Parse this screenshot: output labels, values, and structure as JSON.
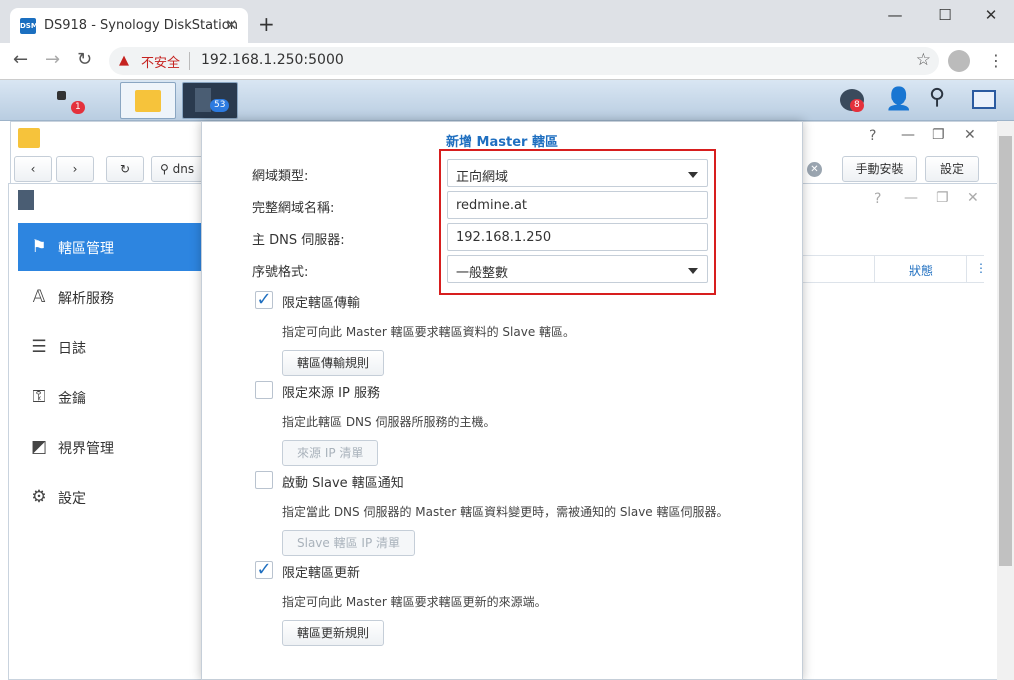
{
  "browser": {
    "tab_title": "DS918 - Synology DiskStation",
    "favicon_text": "DSM",
    "insecure_label": "不安全",
    "url": "192.168.1.250:5000",
    "icons": [
      "back-icon",
      "forward-icon",
      "reload-icon",
      "star-icon",
      "account-icon",
      "menu-icon"
    ]
  },
  "taskbar": {
    "main_menu_badge": "1",
    "dns_badge": "53",
    "notifications_badge": "8"
  },
  "package_center": {
    "search_value": "dns",
    "manual_install_label": "手動安裝",
    "settings_label": "設定"
  },
  "dns_server": {
    "icon_label": "53",
    "sidebar": [
      {
        "label": "轄區管理",
        "icon": "flag-icon",
        "active": true
      },
      {
        "label": "解析服務",
        "icon": "resolve-icon",
        "active": false
      },
      {
        "label": "日誌",
        "icon": "log-icon",
        "active": false
      },
      {
        "label": "金鑰",
        "icon": "key-icon",
        "active": false
      },
      {
        "label": "視界管理",
        "icon": "view-icon",
        "active": false
      },
      {
        "label": "設定",
        "icon": "gear-icon",
        "active": false
      }
    ],
    "table_status_header": "狀態"
  },
  "modal": {
    "title": "新增 Master 轄區",
    "fields": {
      "domain_type_label": "網域類型:",
      "domain_type_value": "正向網域",
      "domain_name_label": "完整網域名稱:",
      "domain_name_value": "redmine.at",
      "dns_server_label": "主 DNS 伺服器:",
      "dns_server_value": "192.168.1.250",
      "serial_label": "序號格式:",
      "serial_value": "一般整數"
    },
    "zone_transfer": {
      "checked": true,
      "label": "限定轄區傳輸",
      "desc": "指定可向此 Master 轄區要求轄區資料的 Slave 轄區。",
      "button": "轄區傳輸規則"
    },
    "source_ip": {
      "checked": false,
      "label": "限定來源 IP 服務",
      "desc": "指定此轄區 DNS 伺服器所服務的主機。",
      "button": "來源 IP 清單"
    },
    "slave_notify": {
      "checked": false,
      "label": "啟動 Slave 轄區通知",
      "desc": "指定當此 DNS 伺服器的 Master 轄區資料變更時，需被通知的 Slave 轄區伺服器。",
      "button": "Slave 轄區 IP 清單"
    },
    "zone_update": {
      "checked": true,
      "label": "限定轄區更新",
      "desc": "指定可向此 Master 轄區要求轄區更新的來源端。",
      "button": "轄區更新規則"
    }
  }
}
